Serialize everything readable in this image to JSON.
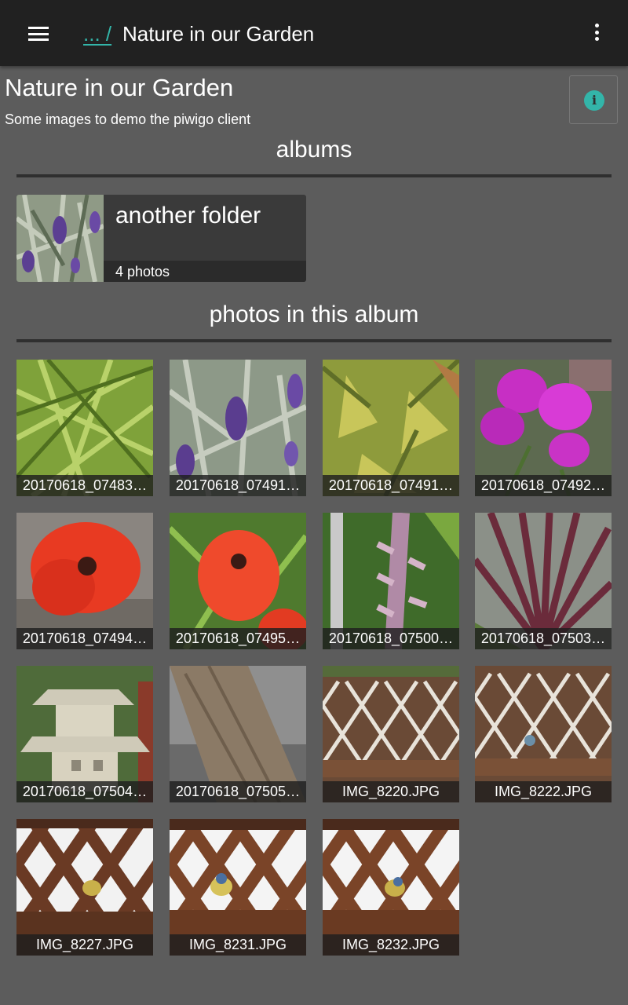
{
  "appbar": {
    "breadcrumb": "... /",
    "title": "Nature in our Garden"
  },
  "album": {
    "title": "Nature in our Garden",
    "description": "Some images to demo the piwigo client"
  },
  "sections": {
    "albums": "albums",
    "photos": "photos in this album"
  },
  "subalbums": [
    {
      "name": "another folder",
      "count": "4 photos"
    }
  ],
  "photos": [
    {
      "caption": "20170618_07483…"
    },
    {
      "caption": "20170618_07491…"
    },
    {
      "caption": "20170618_07491…"
    },
    {
      "caption": "20170618_07492…"
    },
    {
      "caption": "20170618_07494…"
    },
    {
      "caption": "20170618_07495…"
    },
    {
      "caption": "20170618_07500…"
    },
    {
      "caption": "20170618_07503…"
    },
    {
      "caption": "20170618_07504…"
    },
    {
      "caption": "20170618_07505…"
    },
    {
      "caption": "IMG_8220.JPG"
    },
    {
      "caption": "IMG_8222.JPG"
    },
    {
      "caption": "IMG_8227.JPG"
    },
    {
      "caption": "IMG_8231.JPG"
    },
    {
      "caption": "IMG_8232.JPG"
    }
  ],
  "colors": {
    "accent": "#33b5a9",
    "appbar": "#212121",
    "background": "#5c5c5c"
  }
}
